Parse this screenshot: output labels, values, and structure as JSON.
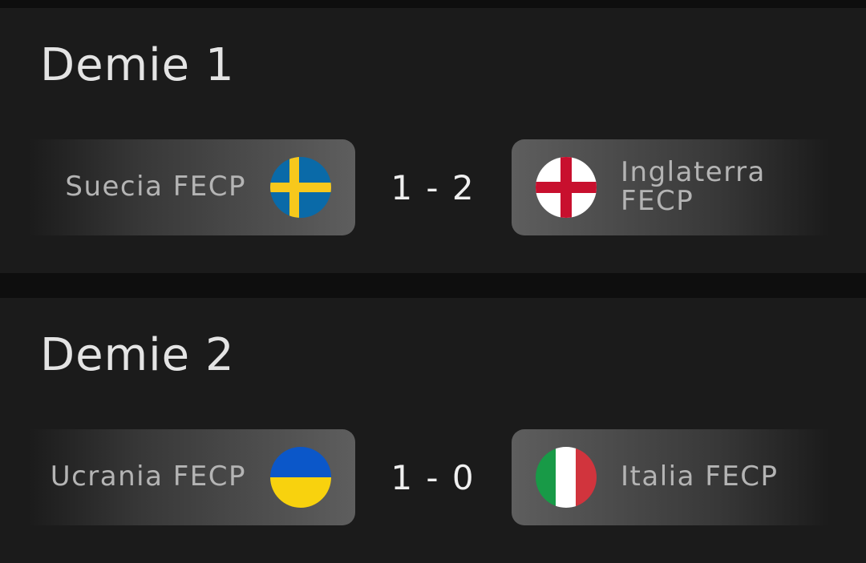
{
  "matches": [
    {
      "title": "Demie 1",
      "home": {
        "name": "Suecia FECP",
        "flag": "sweden-flag-icon"
      },
      "score": "1 - 2",
      "away": {
        "name": "Inglaterra FECP",
        "flag": "england-flag-icon"
      }
    },
    {
      "title": "Demie 2",
      "home": {
        "name": "Ucrania FECP",
        "flag": "ukraine-flag-icon"
      },
      "score": "1 - 0",
      "away": {
        "name": "Italia FECP",
        "flag": "italy-flag-icon"
      }
    }
  ],
  "colors": {
    "background": "#0e0e0e",
    "card": "#1b1b1b",
    "team_chip": "#5e5e5e",
    "title_text": "#e4e4e4",
    "team_text": "#b4b4b4",
    "score_text": "#f0f0f0",
    "sweden_blue": "#0a6aa8",
    "sweden_yellow": "#f7c81c",
    "england_red": "#c8102e",
    "ukraine_blue": "#0b57c9",
    "ukraine_yellow": "#f8d20e",
    "italy_green": "#189a47",
    "italy_red": "#d1343d"
  }
}
